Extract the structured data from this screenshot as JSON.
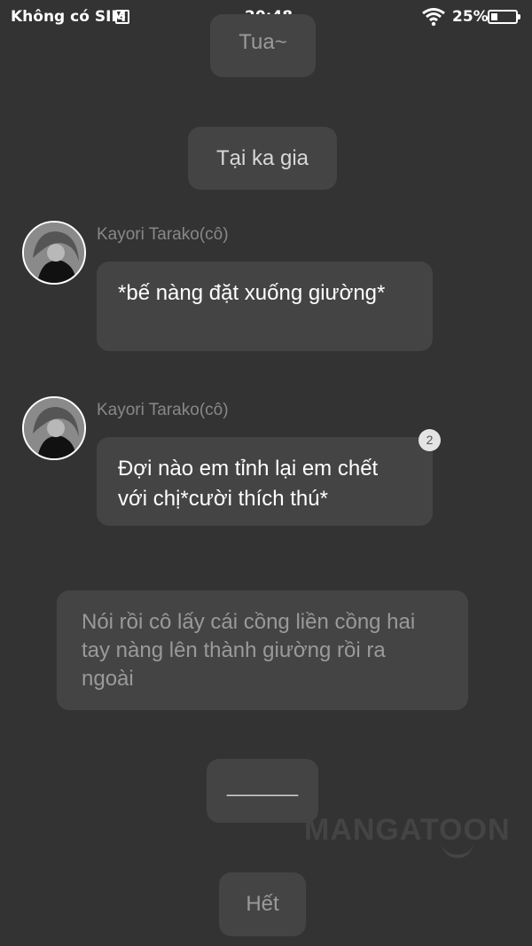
{
  "status_bar": {
    "carrier": "Không có SIM",
    "sim_icon": "S",
    "time": "20:48",
    "battery_percent": "25%",
    "battery_level": 0.25,
    "wifi_icon": "wifi-icon"
  },
  "messages": {
    "top_partial": "Tua~",
    "center_1": "Tại ka gia",
    "msg1": {
      "sender": "Kayori Tarako(cô)",
      "text": "*bế nàng đặt xuống giường*"
    },
    "msg2": {
      "sender": "Kayori Tarako(cô)",
      "text": "Đợi nào em tỉnh lại em chết với chị*cười thích thú*",
      "badge": "2"
    },
    "narration": "Nói rồi cô lấy cái cồng liền cồng hai tay nàng lên thành giường rồi ra ngoài",
    "divider": "______",
    "end": "Hết"
  },
  "watermark": "MANGATOON",
  "colors": {
    "background": "#333333",
    "bubble": "#444444",
    "text_primary": "#ffffff",
    "text_muted": "#9a9a9a"
  }
}
